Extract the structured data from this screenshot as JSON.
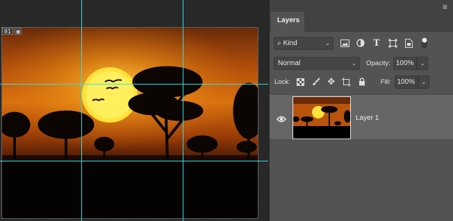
{
  "canvas": {
    "slice_number": "01",
    "slice_icon": "image-slice-icon"
  },
  "panel": {
    "tab_label": "Layers",
    "menu_icon": "panel-menu-icon",
    "filter": {
      "icon": "search-icon",
      "value": "Kind",
      "filter_icons": [
        "image-filter-icon",
        "adjustment-filter-icon",
        "type-filter-icon",
        "shape-filter-icon",
        "smart-object-filter-icon",
        "filter-toggle-icon"
      ]
    },
    "blend_mode": "Normal",
    "opacity_label": "Opacity:",
    "opacity_value": "100%",
    "lock_label": "Lock:",
    "lock_icons": [
      "lock-transparent-pixels-icon",
      "lock-image-pixels-icon",
      "lock-position-icon",
      "lock-artboard-icon",
      "lock-all-icon"
    ],
    "fill_label": "Fill:",
    "fill_value": "100%"
  },
  "layers": [
    {
      "name": "Layer 1",
      "visible": true,
      "selected": true
    }
  ]
}
